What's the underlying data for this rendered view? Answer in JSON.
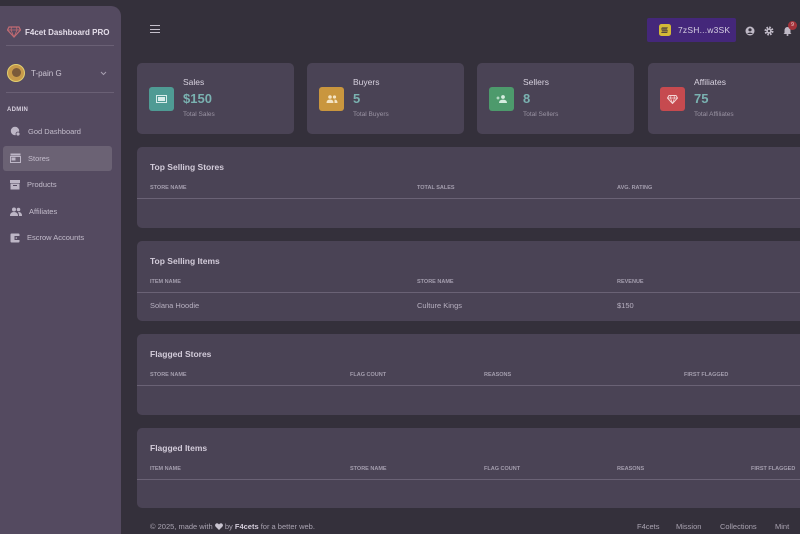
{
  "brand": {
    "name": "F4cet Dashboard PRO",
    "logo_icon": "gem-icon"
  },
  "user": {
    "name": "T-pain G"
  },
  "sidebar": {
    "section_label": "ADMIN",
    "items": [
      {
        "label": "God Dashboard",
        "icon": "dashboard-icon",
        "active": false
      },
      {
        "label": "Stores",
        "icon": "store-icon",
        "active": true
      },
      {
        "label": "Products",
        "icon": "archive-icon",
        "active": false
      },
      {
        "label": "Affiliates",
        "icon": "people-icon",
        "active": false
      },
      {
        "label": "Escrow Accounts",
        "icon": "wallet-icon",
        "active": false
      }
    ]
  },
  "header": {
    "wallet_label": "7zSH...w3SK",
    "notification_count": "9"
  },
  "stats": [
    {
      "title": "Sales",
      "value": "$150",
      "sub": "Total Sales",
      "color": "#4f9b94",
      "icon": "cash-icon"
    },
    {
      "title": "Buyers",
      "value": "5",
      "sub": "Total Buyers",
      "color": "#c9963e",
      "icon": "group-icon"
    },
    {
      "title": "Sellers",
      "value": "8",
      "sub": "Total Sellers",
      "color": "#4d9a6c",
      "icon": "person-add-icon"
    },
    {
      "title": "Affiliates",
      "value": "75",
      "sub": "Total Affiliates",
      "color": "#c64a4f",
      "icon": "diamond-icon"
    }
  ],
  "tables": {
    "top_stores": {
      "title": "Top Selling Stores",
      "headers": [
        "STORE NAME",
        "TOTAL SALES",
        "AVG. RATING"
      ],
      "rows": []
    },
    "top_items": {
      "title": "Top Selling Items",
      "headers": [
        "ITEM NAME",
        "STORE NAME",
        "REVENUE"
      ],
      "rows": [
        [
          "Solana Hoodie",
          "Culture Kings",
          "$150"
        ]
      ]
    },
    "flagged_stores": {
      "title": "Flagged Stores",
      "headers": [
        "STORE NAME",
        "FLAG COUNT",
        "REASONS",
        "FIRST FLAGGED"
      ],
      "rows": []
    },
    "flagged_items": {
      "title": "Flagged Items",
      "headers": [
        "ITEM NAME",
        "STORE NAME",
        "FLAG COUNT",
        "REASONS",
        "FIRST FLAGGED"
      ],
      "rows": []
    }
  },
  "footer": {
    "copyright": "© 2025, made with",
    "by": "by",
    "brand": "F4cets",
    "tail": "for a better web.",
    "links": [
      "F4cets",
      "Mission",
      "Collections",
      "Mint"
    ]
  }
}
